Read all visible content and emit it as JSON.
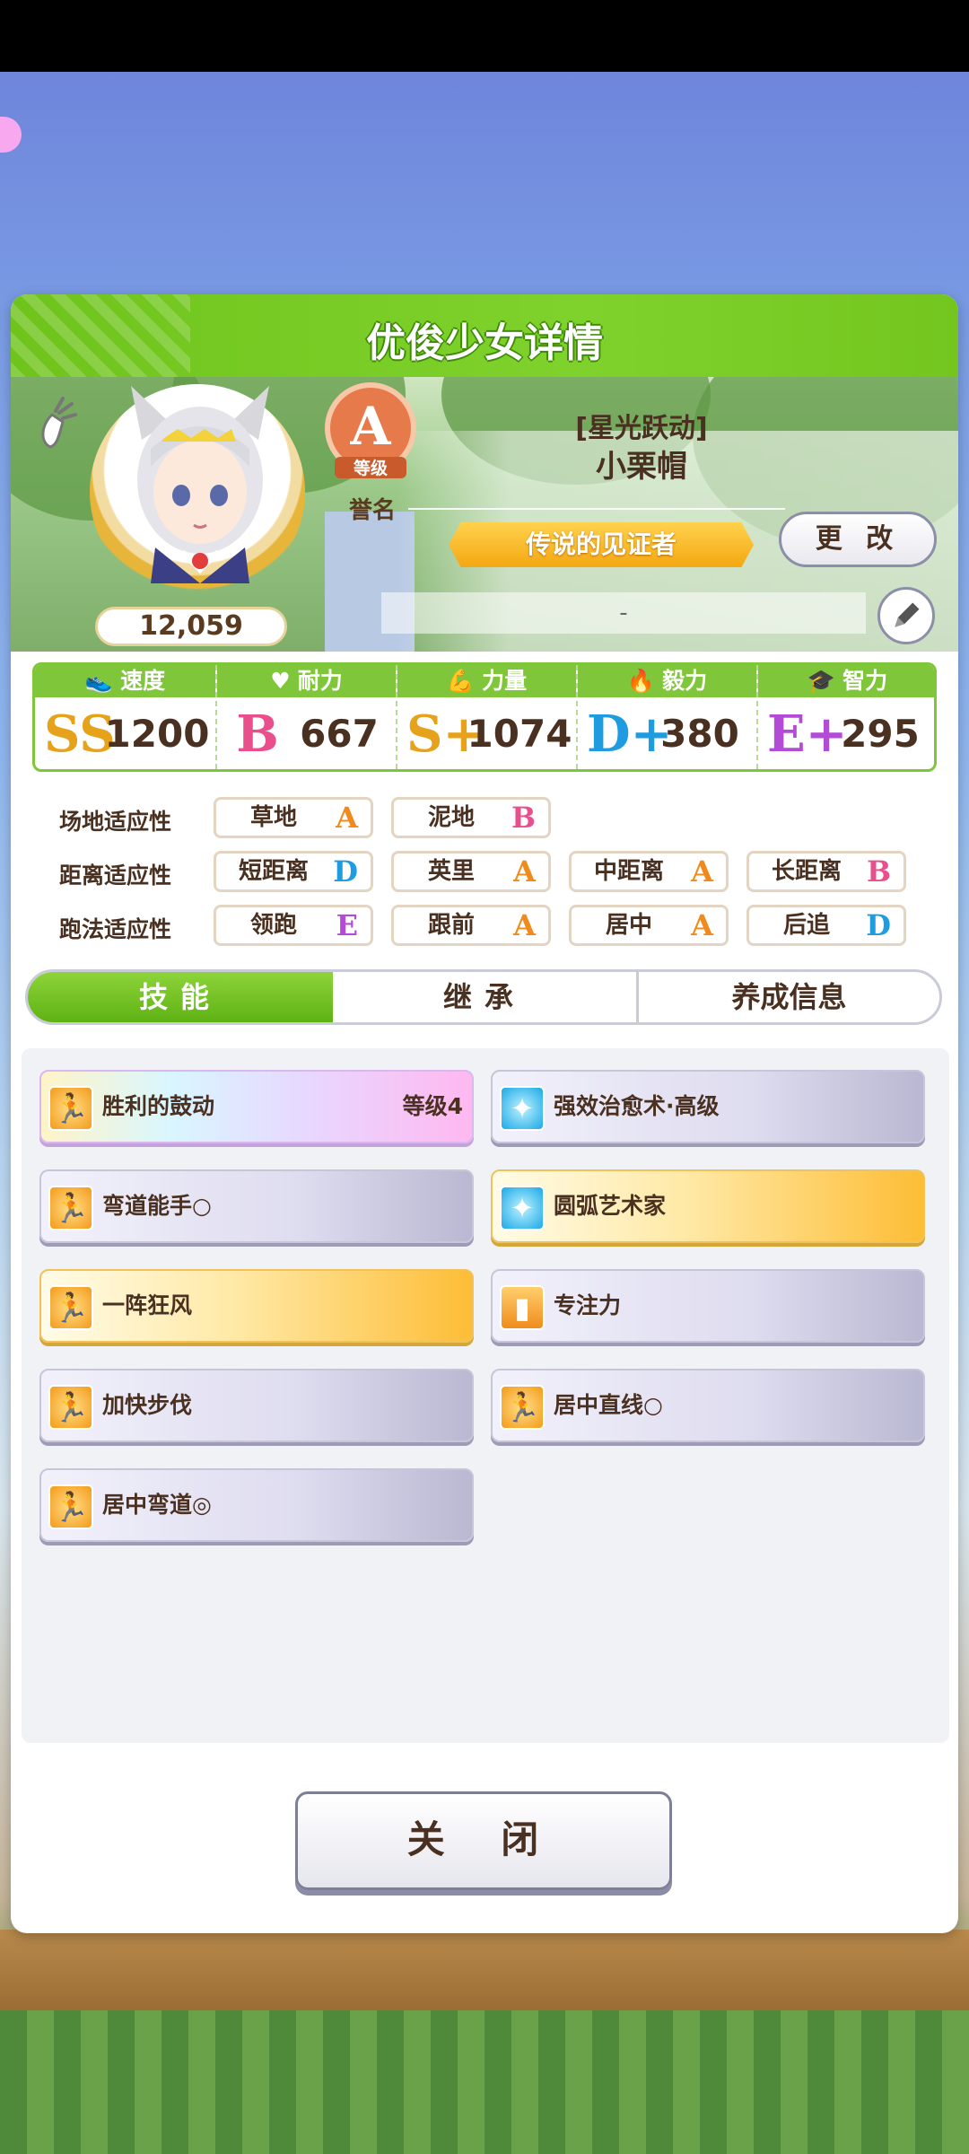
{
  "dialog": {
    "title": "优俊少女详情"
  },
  "profile": {
    "fans": "12,059",
    "rank_grade": "A",
    "rank_badge_text": "等级",
    "rank_label": "誉名",
    "card_subtitle": "[星光跃动]",
    "name": "小栗帽",
    "title": "传说的见证者",
    "change_label": "更 改",
    "comment": "-"
  },
  "stats": [
    {
      "label": "速度",
      "icon": "shoe-icon",
      "grade": "SS",
      "value": "1200",
      "color": "#e7a21b"
    },
    {
      "label": "耐力",
      "icon": "heart-icon",
      "grade": "B",
      "value": "667",
      "color": "#e94f8c"
    },
    {
      "label": "力量",
      "icon": "muscle-icon",
      "grade": "S+",
      "value": "1074",
      "color": "#e7a21b"
    },
    {
      "label": "毅力",
      "icon": "flame-icon",
      "grade": "D+",
      "value": "380",
      "color": "#1f9be0"
    },
    {
      "label": "智力",
      "icon": "cap-icon",
      "grade": "E+",
      "value": "295",
      "color": "#b44bd6"
    }
  ],
  "aptitude": {
    "track_label": "场地适应性",
    "distance_label": "距离适应性",
    "style_label": "跑法适应性",
    "track": [
      {
        "name": "草地",
        "grade": "A"
      },
      {
        "name": "泥地",
        "grade": "B"
      }
    ],
    "distance": [
      {
        "name": "短距离",
        "grade": "D"
      },
      {
        "name": "英里",
        "grade": "A"
      },
      {
        "name": "中距离",
        "grade": "A"
      },
      {
        "name": "长距离",
        "grade": "B"
      }
    ],
    "style": [
      {
        "name": "领跑",
        "grade": "E"
      },
      {
        "name": "跟前",
        "grade": "A"
      },
      {
        "name": "居中",
        "grade": "A"
      },
      {
        "name": "后追",
        "grade": "D"
      }
    ]
  },
  "grade_colors": {
    "A": "#f08a1c",
    "B": "#e94f8c",
    "D": "#1f9be0",
    "E": "#b44bd6"
  },
  "tabs": [
    "技能",
    "继承",
    "养成信息"
  ],
  "skills": [
    {
      "name": "胜利的鼓动",
      "level": "等级4",
      "style": "rainbow",
      "icon": "runner-icon"
    },
    {
      "name": "强效治愈术·高级",
      "style": "silver",
      "icon": "sparkle-icon"
    },
    {
      "name": "弯道能手○",
      "style": "silver",
      "icon": "runner-icon"
    },
    {
      "name": "圆弧艺术家",
      "style": "gold",
      "icon": "sparkle-icon"
    },
    {
      "name": "一阵狂风",
      "style": "gold",
      "icon": "runner-icon"
    },
    {
      "name": "专注力",
      "style": "silver",
      "icon": "gate-icon"
    },
    {
      "name": "加快步伐",
      "style": "silver",
      "icon": "runner-icon"
    },
    {
      "name": "居中直线○",
      "style": "silver",
      "icon": "runner-icon"
    },
    {
      "name": "居中弯道◎",
      "style": "silver",
      "icon": "runner-icon"
    }
  ],
  "close_label": "关 闭"
}
